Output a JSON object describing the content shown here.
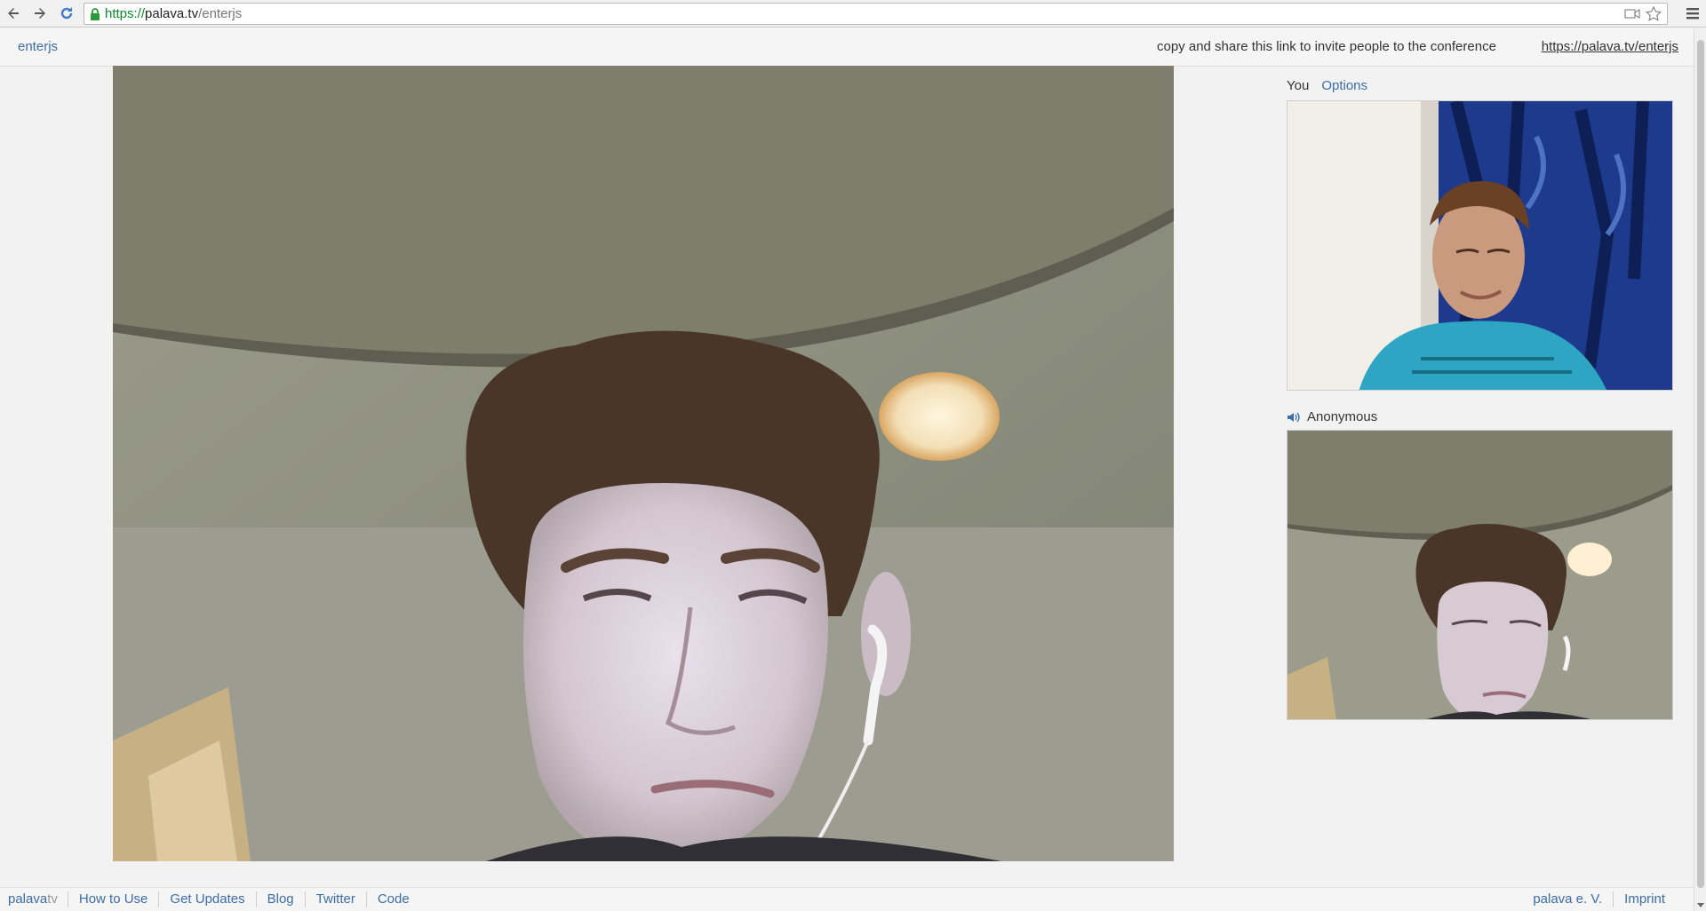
{
  "browser": {
    "url": {
      "scheme": "https://",
      "host": "palava.tv",
      "path": "/enterjs"
    }
  },
  "topbar": {
    "room_name": "enterjs",
    "share_hint": "copy and share this link to invite people to the conference",
    "share_link": "https://palava.tv/enterjs"
  },
  "sidebar": {
    "self_label": "You",
    "options_label": "Options",
    "peer_name": "Anonymous"
  },
  "footer": {
    "brand_a": "palava",
    "brand_b": "tv",
    "links": [
      "How to Use",
      "Get Updates",
      "Blog",
      "Twitter",
      "Code"
    ],
    "right_links": [
      "palava e. V.",
      "Imprint"
    ]
  },
  "colors": {
    "link": "#3b6ea8",
    "secure_green": "#0a8a2a"
  }
}
